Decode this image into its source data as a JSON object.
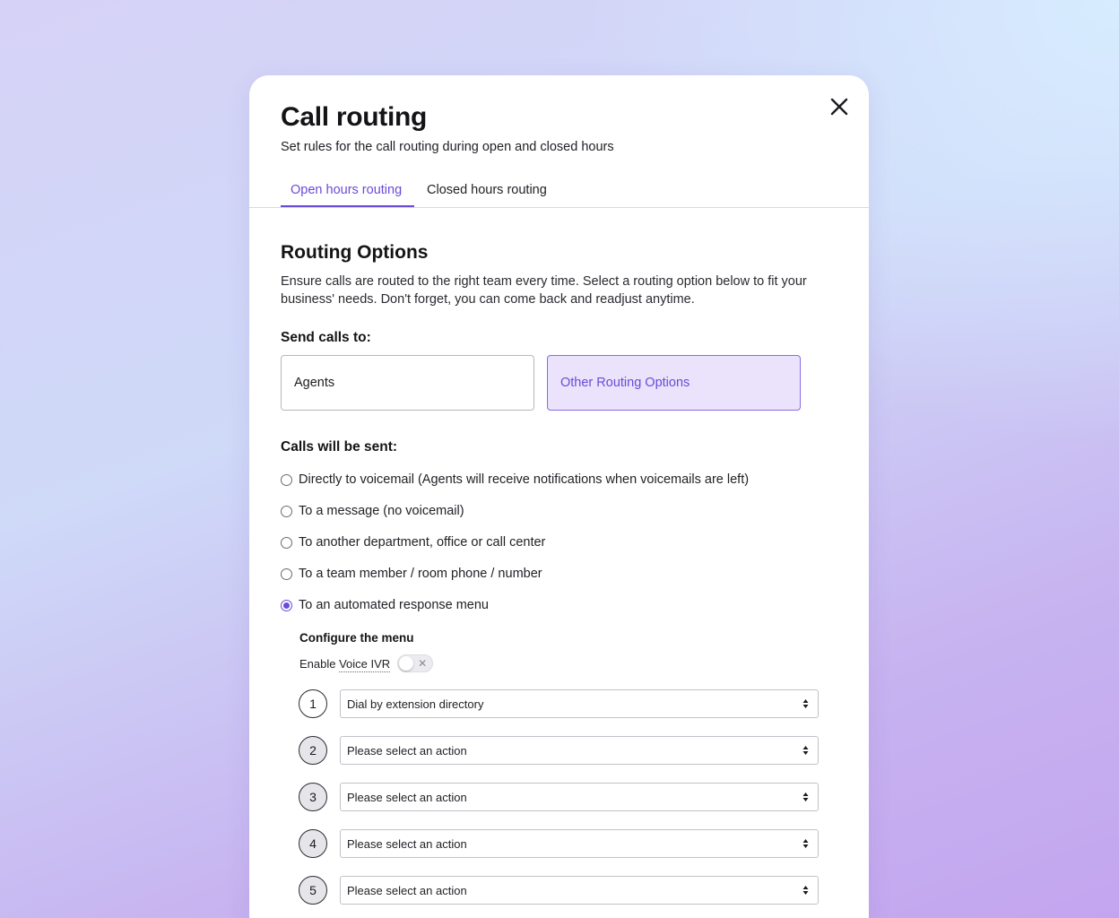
{
  "modal": {
    "title": "Call routing",
    "subtitle": "Set rules for the call routing during open and closed hours"
  },
  "tabs": [
    {
      "label": "Open hours routing",
      "active": true
    },
    {
      "label": "Closed hours routing",
      "active": false
    }
  ],
  "routing": {
    "title": "Routing Options",
    "description": "Ensure calls are routed to the right team every time. Select a routing option below to fit your business' needs. Don't forget, you can come back and readjust anytime.",
    "send_label": "Send calls to:",
    "cards": [
      {
        "label": "Agents",
        "selected": false
      },
      {
        "label": "Other Routing Options",
        "selected": true
      }
    ],
    "sent_label": "Calls will be sent:",
    "options": [
      {
        "label": "Directly to voicemail (Agents will receive notifications when voicemails are left)",
        "checked": false
      },
      {
        "label": "To a message (no voicemail)",
        "checked": false
      },
      {
        "label": "To another department, office or call center",
        "checked": false
      },
      {
        "label": "To a team member / room phone / number",
        "checked": false
      },
      {
        "label": "To an automated response menu",
        "checked": true
      }
    ]
  },
  "config": {
    "title": "Configure the menu",
    "ivr_label_prefix": "Enable ",
    "ivr_label_term": "Voice IVR",
    "ivr_enabled": false,
    "menu": [
      {
        "number": "1",
        "value": "Dial by extension directory"
      },
      {
        "number": "2",
        "value": "Please select an action"
      },
      {
        "number": "3",
        "value": "Please select an action"
      },
      {
        "number": "4",
        "value": "Please select an action"
      },
      {
        "number": "5",
        "value": "Please select an action"
      }
    ]
  },
  "colors": {
    "accent": "#6a4bd9",
    "card_selected_bg": "#ebe2fb"
  },
  "icons": {
    "close": "close-icon",
    "toggle_off": "x-icon",
    "select": "sort-arrows-icon"
  }
}
